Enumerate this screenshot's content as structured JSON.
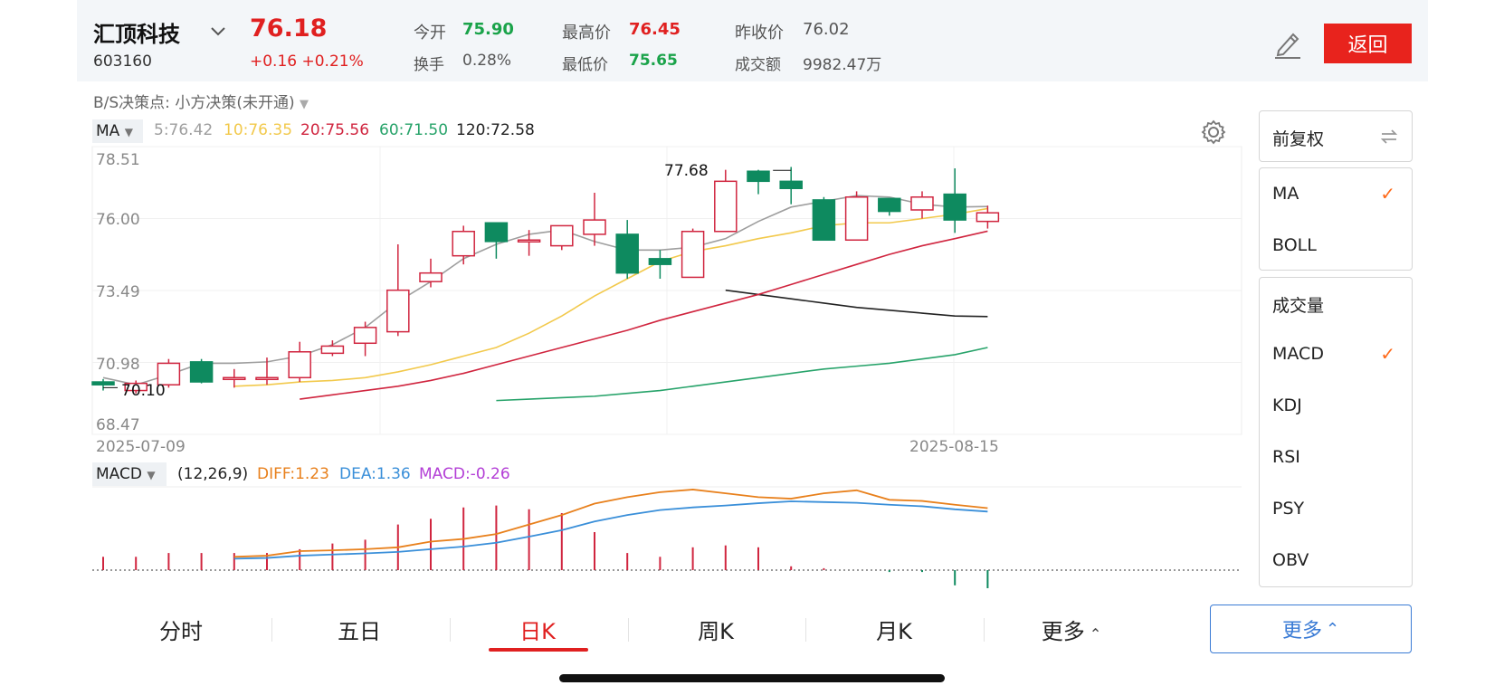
{
  "stock": {
    "name": "汇顶科技",
    "code": "603160",
    "price": "76.18",
    "change": "+0.16 +0.21%",
    "open_label": "今开",
    "open_value": "75.90",
    "turnover_label": "换手",
    "turnover_value": "0.28%",
    "high_label": "最高价",
    "high_value": "76.45",
    "low_label": "最低价",
    "low_value": "75.65",
    "prev_close_label": "昨收价",
    "prev_close_value": "76.02",
    "amount_label": "成交额",
    "amount_value": "9982.47万"
  },
  "header": {
    "back_label": "返回",
    "icons": [
      "chevron-down-icon",
      "edit-pencil-icon"
    ]
  },
  "bs_decision": {
    "label": "B/S决策点:",
    "value": "小方决策(未开通)"
  },
  "ma_legend": {
    "name": "MA",
    "ma5": "5:76.42",
    "ma10": "10:76.35",
    "ma20": "20:75.56",
    "ma60": "60:71.50",
    "ma120": "120:72.58",
    "colors": {
      "ma5": "#9e9e9e",
      "ma10": "#f2c94c",
      "ma20": "#d0253f",
      "ma60": "#27a36a",
      "ma120": "#222222"
    }
  },
  "price_axis": {
    "ticks": [
      "78.51",
      "76.00",
      "73.49",
      "70.98",
      "68.47"
    ],
    "max_label": "77.68",
    "min_label": "70.10"
  },
  "date_axis": {
    "start": "2025-07-09",
    "mid": "2025-08-15"
  },
  "macd_legend": {
    "name": "MACD",
    "params": "(12,26,9)",
    "diff": "DIFF:1.23",
    "dea": "DEA:1.36",
    "macd": "MACD:-0.26",
    "colors": {
      "diff": "#e8801c",
      "dea": "#3a8fd9",
      "macd": "#b33fd6"
    }
  },
  "side_panel": {
    "adjust_label": "前复权",
    "main_indicators": [
      {
        "label": "MA",
        "checked": true
      },
      {
        "label": "BOLL",
        "checked": false
      }
    ],
    "sub_indicators": [
      {
        "label": "成交量",
        "checked": false
      },
      {
        "label": "MACD",
        "checked": true
      },
      {
        "label": "KDJ",
        "checked": false
      },
      {
        "label": "RSI",
        "checked": false
      },
      {
        "label": "PSY",
        "checked": false
      },
      {
        "label": "OBV",
        "checked": false
      }
    ],
    "check_mark": "✓"
  },
  "tabs": [
    {
      "label": "分时",
      "active": false
    },
    {
      "label": "五日",
      "active": false
    },
    {
      "label": "日K",
      "active": true
    },
    {
      "label": "周K",
      "active": false
    },
    {
      "label": "月K",
      "active": false
    },
    {
      "label": "更多",
      "active": false
    }
  ],
  "more_button": {
    "label": "更多"
  },
  "chart_data": [
    {
      "type": "candlestick",
      "x_start": "2025-07-09",
      "x_mark": "2025-08-15",
      "ylim": [
        68.47,
        78.51
      ],
      "y_ticks": [
        78.51,
        76.0,
        73.49,
        70.98,
        68.47
      ],
      "ohlc": [
        [
          70.3,
          70.2,
          70.4,
          70.0
        ],
        [
          70.0,
          70.25,
          70.35,
          69.9
        ],
        [
          70.2,
          70.95,
          71.1,
          70.1
        ],
        [
          71.0,
          70.3,
          71.1,
          70.25
        ],
        [
          70.45,
          70.45,
          70.75,
          70.1
        ],
        [
          70.4,
          70.45,
          71.15,
          70.2
        ],
        [
          70.45,
          71.35,
          71.7,
          70.3
        ],
        [
          71.3,
          71.55,
          71.75,
          71.2
        ],
        [
          71.65,
          72.2,
          72.4,
          71.2
        ],
        [
          72.05,
          73.5,
          75.1,
          71.9
        ],
        [
          73.8,
          74.1,
          74.6,
          73.6
        ],
        [
          74.7,
          75.55,
          75.75,
          74.4
        ],
        [
          75.85,
          75.2,
          75.85,
          74.6
        ],
        [
          75.25,
          75.25,
          75.6,
          74.7
        ],
        [
          75.05,
          75.75,
          75.75,
          74.9
        ],
        [
          75.45,
          75.95,
          76.9,
          75.05
        ],
        [
          75.45,
          74.1,
          75.95,
          73.9
        ],
        [
          74.6,
          74.4,
          74.9,
          73.9
        ],
        [
          73.95,
          75.55,
          75.65,
          73.95
        ],
        [
          75.55,
          77.3,
          77.7,
          75.6
        ],
        [
          77.65,
          77.3,
          77.7,
          76.85
        ],
        [
          77.3,
          77.05,
          77.8,
          76.5
        ],
        [
          76.65,
          75.25,
          76.75,
          75.25
        ],
        [
          75.25,
          76.75,
          76.95,
          75.25
        ],
        [
          76.7,
          76.25,
          76.7,
          76.1
        ],
        [
          76.3,
          76.75,
          76.95,
          76.0
        ],
        [
          76.85,
          75.95,
          77.75,
          75.5
        ],
        [
          75.9,
          76.2,
          76.45,
          75.65
        ]
      ],
      "ma5": [
        70.45,
        70.2,
        70.55,
        70.95,
        70.95,
        71.0,
        71.2,
        71.6,
        72.2,
        73.1,
        73.8,
        74.6,
        75.1,
        75.45,
        75.6,
        75.2,
        74.9,
        74.9,
        75.0,
        75.3,
        75.9,
        76.4,
        76.6,
        76.8,
        76.75,
        76.5,
        76.4,
        76.42
      ],
      "ma10": [
        70.15,
        70.2,
        70.3,
        70.35,
        70.45,
        70.65,
        70.9,
        71.2,
        71.5,
        72.0,
        72.6,
        73.3,
        73.9,
        74.5,
        74.85,
        75.05,
        75.3,
        75.5,
        75.75,
        75.85,
        75.85,
        76.0,
        76.15,
        76.35
      ],
      "ma20": [
        69.7,
        69.85,
        70.0,
        70.15,
        70.35,
        70.6,
        70.9,
        71.2,
        71.5,
        71.8,
        72.1,
        72.45,
        72.75,
        73.05,
        73.35,
        73.7,
        74.05,
        74.4,
        74.75,
        75.05,
        75.3,
        75.56
      ],
      "ma60": [
        69.65,
        69.7,
        69.75,
        69.8,
        69.9,
        70.0,
        70.15,
        70.3,
        70.45,
        70.6,
        70.75,
        70.85,
        70.95,
        71.1,
        71.25,
        71.5
      ],
      "ma120": [
        73.5,
        73.35,
        73.2,
        73.05,
        72.9,
        72.8,
        72.7,
        72.6,
        72.58
      ],
      "max_label": 77.68,
      "min_label": 70.1
    },
    {
      "type": "line+bar",
      "name": "MACD",
      "diff": [
        0.35,
        0.38,
        0.5,
        0.52,
        0.55,
        0.6,
        0.75,
        0.82,
        0.95,
        1.2,
        1.45,
        1.75,
        1.92,
        2.05,
        2.12,
        2.02,
        1.92,
        1.88,
        2.02,
        2.1,
        1.85,
        1.82,
        1.72,
        1.63
      ],
      "dea": [
        0.3,
        0.32,
        0.38,
        0.41,
        0.44,
        0.48,
        0.55,
        0.62,
        0.72,
        0.88,
        1.05,
        1.28,
        1.45,
        1.58,
        1.65,
        1.7,
        1.76,
        1.81,
        1.79,
        1.77,
        1.72,
        1.68,
        1.6,
        1.54
      ],
      "macd": [
        0.35,
        0.35,
        0.45,
        0.45,
        0.45,
        0.45,
        0.55,
        0.7,
        0.8,
        1.2,
        1.35,
        1.65,
        1.7,
        1.6,
        1.5,
        1.0,
        0.45,
        0.35,
        0.6,
        0.65,
        0.6,
        0.1,
        0.05,
        0.0,
        -0.05,
        -0.05,
        -0.4,
        -0.5
      ]
    }
  ]
}
